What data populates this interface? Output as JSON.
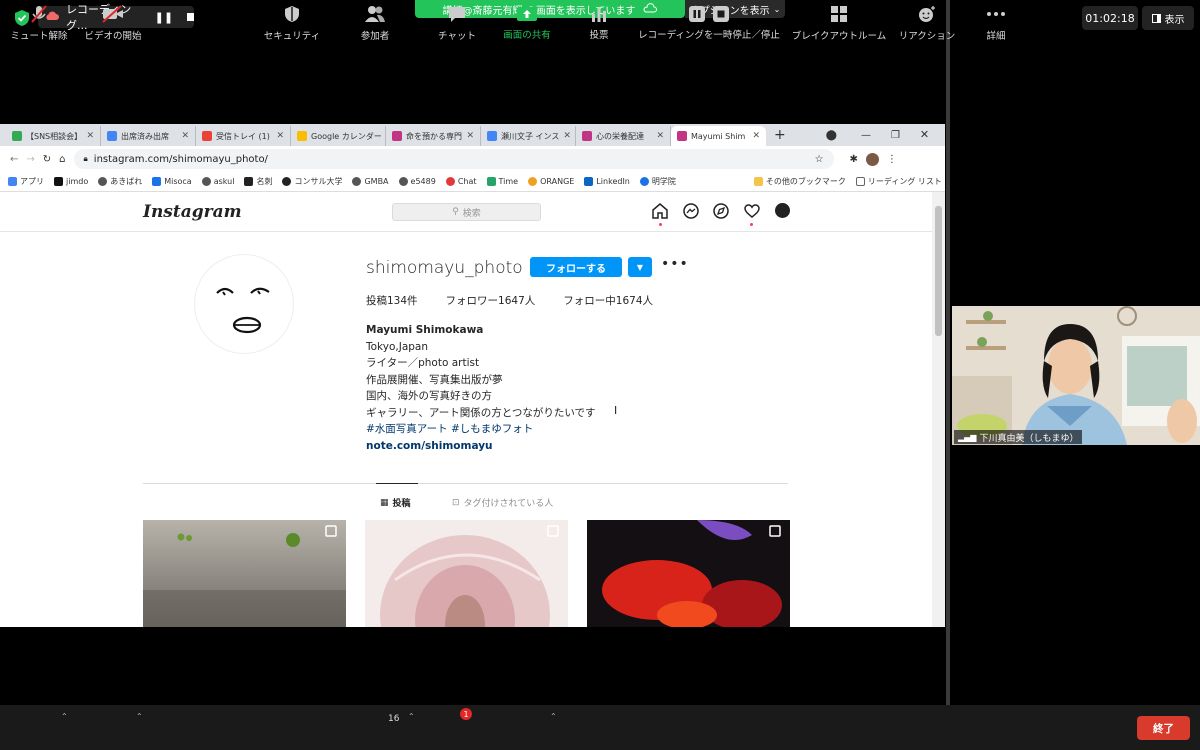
{
  "zoom_top": {
    "recording_label": "レコーディング...",
    "share_banner": "講師@斎藤元有輝 の画面を表示しています",
    "options_label": "オプションを表示",
    "timer": "01:02:18",
    "view_label": "表示"
  },
  "browser": {
    "tabs": [
      {
        "label": "【SNS相談会】",
        "color": "#34a853"
      },
      {
        "label": "出席済み出席",
        "color": "#4285f4"
      },
      {
        "label": "受信トレイ (1)",
        "color": "#ea4335"
      },
      {
        "label": "Google カレンダー",
        "color": "#fbbc04"
      },
      {
        "label": "命を預かる専門",
        "color": "#c13584"
      },
      {
        "label": "瀬川文子 インス",
        "color": "#4285f4"
      },
      {
        "label": "心の栄養配達",
        "color": "#c13584"
      },
      {
        "label": "Mayumi Shim",
        "color": "#c13584"
      }
    ],
    "url": "instagram.com/shimomayu_photo/",
    "bookmarks": [
      "アプリ",
      "jimdo",
      "あきばれ",
      "Misoca",
      "askul",
      "名刺",
      "コンサル大学",
      "GMBA",
      "e5489",
      "Chat",
      "Time",
      "ORANGE",
      "LinkedIn",
      "明学院"
    ],
    "other_bookmarks": "その他のブックマーク",
    "reading_list": "リーディング リスト"
  },
  "instagram": {
    "logo": "Instagram",
    "search_placeholder": "検索",
    "username": "shimomayu_photo",
    "follow_button": "フォローする",
    "stats": {
      "posts": "投稿134件",
      "followers": "フォロワー1647人",
      "following": "フォロー中1674人"
    },
    "bio": {
      "name": "Mayumi Shimokawa",
      "lines": [
        "Tokyo,Japan",
        "ライター／photo artist",
        "作品展開催、写真集出版が夢",
        "国内、海外の写真好きの方",
        "ギャラリー、アート関係の方とつながりたいです"
      ],
      "hashtags": "#水面写真アート #しもまゆフォト",
      "link": "note.com/shimomayu"
    },
    "tab_posts": "投稿",
    "tab_tagged": "タグ付けされている人"
  },
  "video": {
    "participant_name": "下川真由美（しもまゆ）"
  },
  "toolbar": {
    "unmute": "ミュート解除",
    "start_video": "ビデオの開始",
    "security": "セキュリティ",
    "participants": "参加者",
    "participants_count": "16",
    "chat": "チャット",
    "chat_badge": "1",
    "share_screen": "画面の共有",
    "polls": "投票",
    "recording": "レコーディングを一時停止／停止",
    "breakout": "ブレイクアウトルーム",
    "reactions": "リアクション",
    "more": "詳細",
    "end": "終了"
  }
}
